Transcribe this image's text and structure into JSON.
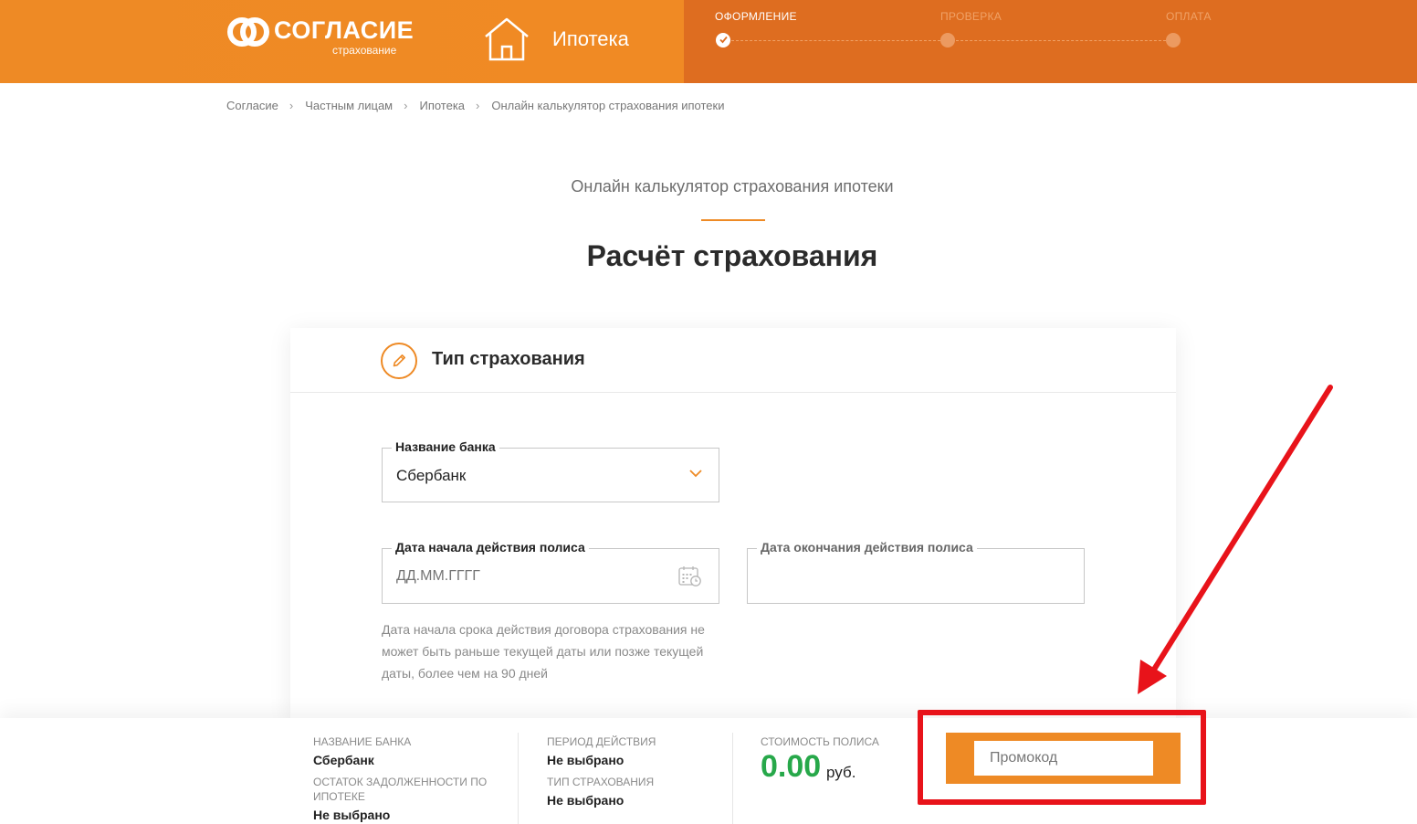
{
  "header": {
    "brand_name": "СОГЛАСИЕ",
    "brand_sub": "страхование",
    "product": "Ипотека",
    "steps": [
      {
        "label": "ОФОРМЛЕНИЕ",
        "state": "done"
      },
      {
        "label": "ПРОВЕРКА",
        "state": "todo"
      },
      {
        "label": "ОПЛАТА",
        "state": "todo"
      }
    ]
  },
  "breadcrumb": [
    "Согласие",
    "Частным лицам",
    "Ипотека",
    "Онлайн калькулятор страхования ипотеки"
  ],
  "page": {
    "subtitle": "Онлайн калькулятор страхования ипотеки",
    "title": "Расчёт страхования"
  },
  "card": {
    "title": "Тип страхования",
    "bank_field": {
      "label": "Название банка",
      "value": "Сбербанк"
    },
    "start_date_field": {
      "label": "Дата начала действия полиса",
      "placeholder": "ДД.ММ.ГГГГ"
    },
    "end_date_field": {
      "label": "Дата окончания действия полиса"
    },
    "hint": "Дата начала срока действия договора страхования не может быть раньше текущей даты или позже текущей даты, более чем на 90 дней"
  },
  "summary": {
    "bank_label": "НАЗВАНИЕ БАНКА",
    "bank_value": "Сбербанк",
    "debt_label": "ОСТАТОК ЗАДОЛЖЕННОСТИ ПО ИПОТЕКЕ",
    "debt_value": "Не выбрано",
    "period_label": "ПЕРИОД ДЕЙСТВИЯ",
    "period_value": "Не выбрано",
    "type_label": "ТИП СТРАХОВАНИЯ",
    "type_value": "Не выбрано",
    "cost_label": "СТОИМОСТЬ ПОЛИСА",
    "cost_value": "0.00",
    "cost_unit": "руб.",
    "promo_placeholder": "Промокод"
  },
  "colors": {
    "brand_orange": "#ee8a25",
    "header_dark_orange": "#de6d20",
    "price_green": "#27a84a",
    "annotation_red": "#e8131a"
  },
  "icons": {
    "logo": "logo-icon",
    "product": "house-icon",
    "card": "pencil-icon",
    "select": "chevron-down-icon",
    "date": "calendar-icon",
    "step_done": "check-icon"
  }
}
